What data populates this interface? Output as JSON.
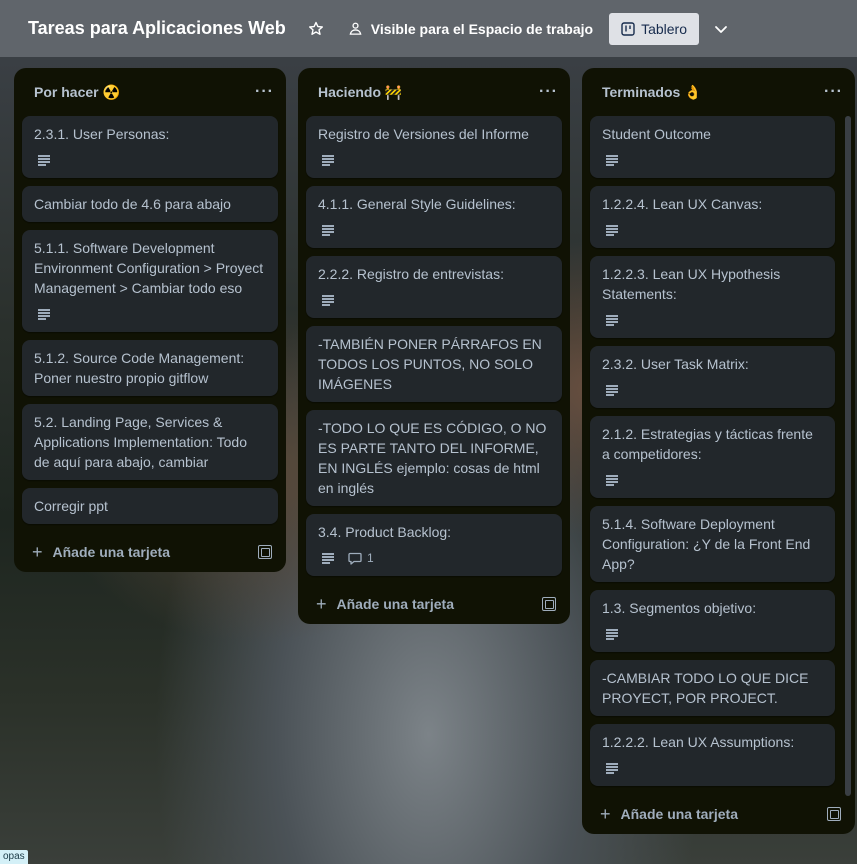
{
  "header": {
    "title": "Tareas para Aplicaciones Web",
    "visibility": "Visible para el Espacio de trabajo",
    "view": "Tablero"
  },
  "lists": [
    {
      "title": "Por hacer ☢️",
      "cards": [
        {
          "text": "2.3.1. User Personas:",
          "desc": true
        },
        {
          "text": "Cambiar todo de 4.6 para abajo",
          "desc": false
        },
        {
          "text": "5.1.1. Software Development Environment Configuration > Proyect Management > Cambiar todo eso",
          "desc": true
        },
        {
          "text": "5.1.2. Source Code Management: Poner nuestro propio gitflow",
          "desc": false
        },
        {
          "text": "5.2. Landing Page, Services & Applications Implementation: Todo de aquí para abajo, cambiar",
          "desc": false
        },
        {
          "text": "Corregir ppt",
          "desc": false
        }
      ],
      "add_label": "Añade una tarjeta"
    },
    {
      "title": "Haciendo 🚧",
      "cards": [
        {
          "text": "Registro de Versiones del Informe",
          "desc": true
        },
        {
          "text": "4.1.1. General Style Guidelines:",
          "desc": true
        },
        {
          "text": "2.2.2. Registro de entrevistas:",
          "desc": true
        },
        {
          "text": "-TAMBIÉN PONER PÁRRAFOS EN TODOS LOS PUNTOS, NO SOLO IMÁGENES",
          "desc": false
        },
        {
          "text": "-TODO LO QUE ES CÓDIGO, O NO ES PARTE TANTO DEL INFORME, EN INGLÉS ejemplo: cosas de html en inglés",
          "desc": false
        },
        {
          "text": "3.4. Product Backlog:",
          "desc": true,
          "comments": "1"
        }
      ],
      "add_label": "Añade una tarjeta"
    },
    {
      "title": "Terminados 👌",
      "cards": [
        {
          "text": "Student Outcome",
          "desc": true
        },
        {
          "text": "1.2.2.4. Lean UX Canvas:",
          "desc": true
        },
        {
          "text": "1.2.2.3. Lean UX Hypothesis Statements:",
          "desc": true
        },
        {
          "text": "2.3.2. User Task Matrix:",
          "desc": true
        },
        {
          "text": "2.1.2. Estrategias y tácticas frente a competidores:",
          "desc": true
        },
        {
          "text": "5.1.4. Software Deployment Configuration: ¿Y de la Front End App?",
          "desc": false
        },
        {
          "text": "1.3. Segmentos objetivo:",
          "desc": true
        },
        {
          "text": "-CAMBIAR TODO LO QUE DICE PROYECT, POR PROJECT.",
          "desc": false
        },
        {
          "text": "1.2.2.2. Lean UX Assumptions:",
          "desc": true
        }
      ],
      "add_label": "Añade una tarjeta"
    }
  ],
  "corner_tag": "opas"
}
